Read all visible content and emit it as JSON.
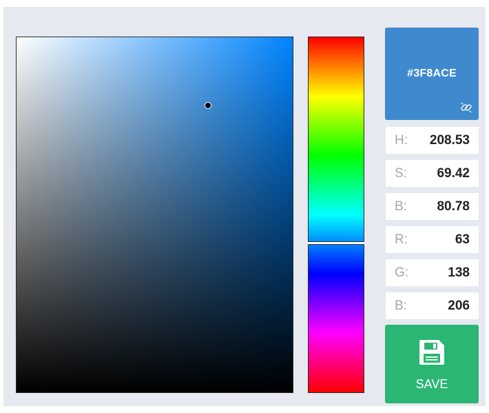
{
  "color": {
    "hex": "#3F8ACE",
    "hue_color": "#0084ff",
    "hue_fraction": 0.579,
    "saturation_fraction": 0.694,
    "brightness_fraction": 0.808
  },
  "fields": [
    {
      "label": "H:",
      "value": "208.53"
    },
    {
      "label": "S:",
      "value": "69.42"
    },
    {
      "label": "B:",
      "value": "80.78"
    },
    {
      "label": "R:",
      "value": "63"
    },
    {
      "label": "G:",
      "value": "138"
    },
    {
      "label": "B:",
      "value": "206"
    }
  ],
  "save": {
    "label": "SAVE",
    "color": "#2bb673"
  },
  "icons": {
    "link": "link-icon",
    "save": "floppy-disk-icon"
  }
}
